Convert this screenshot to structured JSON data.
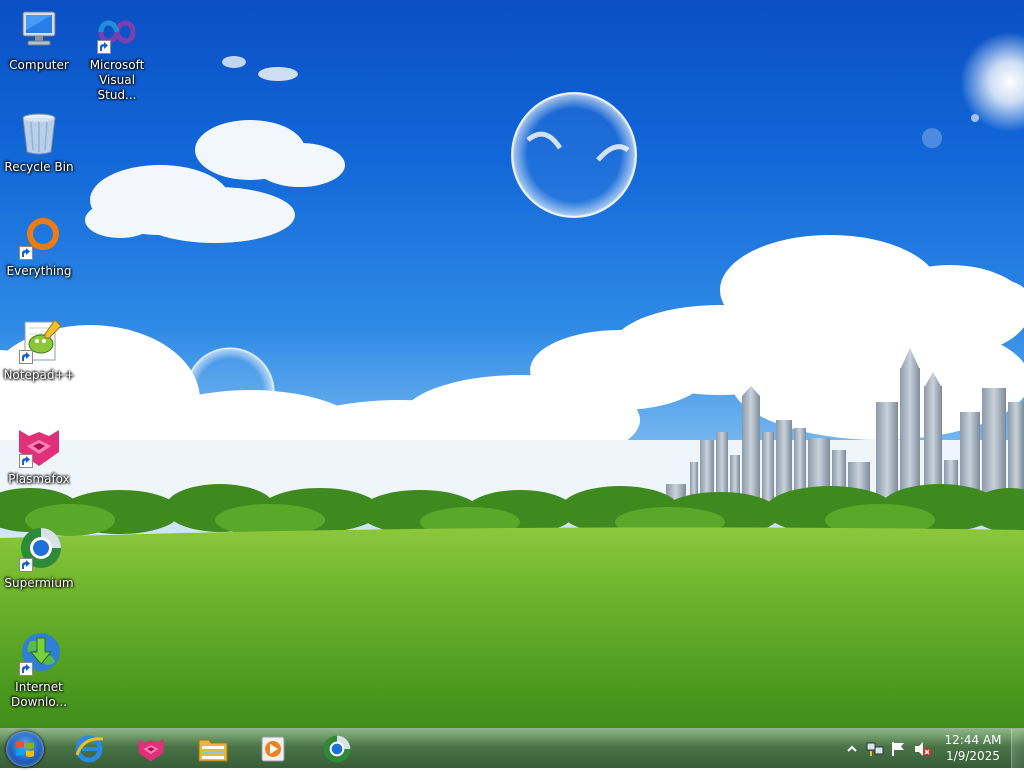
{
  "desktop": {
    "icons": [
      {
        "label": "Computer",
        "icon": "computer-icon",
        "shortcut": false
      },
      {
        "label": "Microsoft Visual Stud...",
        "icon": "visual-studio-icon",
        "shortcut": true
      },
      {
        "label": "Recycle Bin",
        "icon": "recycle-bin-icon",
        "shortcut": false
      },
      {
        "label": "Everything",
        "icon": "everything-search-icon",
        "shortcut": true
      },
      {
        "label": "Notepad++",
        "icon": "notepad-plus-plus-icon",
        "shortcut": true
      },
      {
        "label": "Plasmafox",
        "icon": "plasmafox-icon",
        "shortcut": true
      },
      {
        "label": "Supermium",
        "icon": "supermium-icon",
        "shortcut": true
      },
      {
        "label": "Internet Downlo...",
        "icon": "internet-download-manager-icon",
        "shortcut": true
      }
    ]
  },
  "taskbar": {
    "start_icon": "windows-start-icon",
    "pinned": [
      {
        "icon": "internet-explorer-icon"
      },
      {
        "icon": "plasmafox-icon"
      },
      {
        "icon": "file-explorer-icon"
      },
      {
        "icon": "media-player-icon"
      },
      {
        "icon": "supermium-icon"
      }
    ],
    "tray": {
      "icons": [
        "show-hidden-icons-chevron",
        "network-icon",
        "action-center-flag-icon",
        "volume-muted-icon"
      ],
      "time": "12:44 AM",
      "date": "1/9/2025"
    }
  },
  "colors": {
    "sky_top": "#0a4fc4",
    "grass": "#5fae2a",
    "taskbar": "#3a6838",
    "icon_label": "#ffffff"
  }
}
